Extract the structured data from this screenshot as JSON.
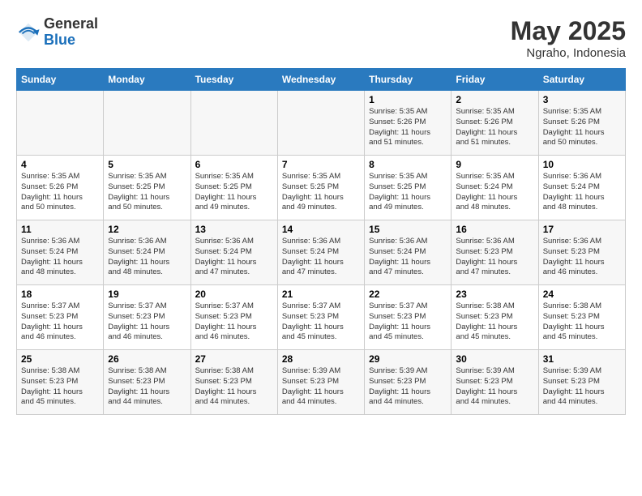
{
  "logo": {
    "general": "General",
    "blue": "Blue"
  },
  "title": "May 2025",
  "subtitle": "Ngraho, Indonesia",
  "days_of_week": [
    "Sunday",
    "Monday",
    "Tuesday",
    "Wednesday",
    "Thursday",
    "Friday",
    "Saturday"
  ],
  "weeks": [
    [
      {
        "day": "",
        "info": ""
      },
      {
        "day": "",
        "info": ""
      },
      {
        "day": "",
        "info": ""
      },
      {
        "day": "",
        "info": ""
      },
      {
        "day": "1",
        "info": "Sunrise: 5:35 AM\nSunset: 5:26 PM\nDaylight: 11 hours\nand 51 minutes."
      },
      {
        "day": "2",
        "info": "Sunrise: 5:35 AM\nSunset: 5:26 PM\nDaylight: 11 hours\nand 51 minutes."
      },
      {
        "day": "3",
        "info": "Sunrise: 5:35 AM\nSunset: 5:26 PM\nDaylight: 11 hours\nand 50 minutes."
      }
    ],
    [
      {
        "day": "4",
        "info": "Sunrise: 5:35 AM\nSunset: 5:26 PM\nDaylight: 11 hours\nand 50 minutes."
      },
      {
        "day": "5",
        "info": "Sunrise: 5:35 AM\nSunset: 5:25 PM\nDaylight: 11 hours\nand 50 minutes."
      },
      {
        "day": "6",
        "info": "Sunrise: 5:35 AM\nSunset: 5:25 PM\nDaylight: 11 hours\nand 49 minutes."
      },
      {
        "day": "7",
        "info": "Sunrise: 5:35 AM\nSunset: 5:25 PM\nDaylight: 11 hours\nand 49 minutes."
      },
      {
        "day": "8",
        "info": "Sunrise: 5:35 AM\nSunset: 5:25 PM\nDaylight: 11 hours\nand 49 minutes."
      },
      {
        "day": "9",
        "info": "Sunrise: 5:35 AM\nSunset: 5:24 PM\nDaylight: 11 hours\nand 48 minutes."
      },
      {
        "day": "10",
        "info": "Sunrise: 5:36 AM\nSunset: 5:24 PM\nDaylight: 11 hours\nand 48 minutes."
      }
    ],
    [
      {
        "day": "11",
        "info": "Sunrise: 5:36 AM\nSunset: 5:24 PM\nDaylight: 11 hours\nand 48 minutes."
      },
      {
        "day": "12",
        "info": "Sunrise: 5:36 AM\nSunset: 5:24 PM\nDaylight: 11 hours\nand 48 minutes."
      },
      {
        "day": "13",
        "info": "Sunrise: 5:36 AM\nSunset: 5:24 PM\nDaylight: 11 hours\nand 47 minutes."
      },
      {
        "day": "14",
        "info": "Sunrise: 5:36 AM\nSunset: 5:24 PM\nDaylight: 11 hours\nand 47 minutes."
      },
      {
        "day": "15",
        "info": "Sunrise: 5:36 AM\nSunset: 5:24 PM\nDaylight: 11 hours\nand 47 minutes."
      },
      {
        "day": "16",
        "info": "Sunrise: 5:36 AM\nSunset: 5:23 PM\nDaylight: 11 hours\nand 47 minutes."
      },
      {
        "day": "17",
        "info": "Sunrise: 5:36 AM\nSunset: 5:23 PM\nDaylight: 11 hours\nand 46 minutes."
      }
    ],
    [
      {
        "day": "18",
        "info": "Sunrise: 5:37 AM\nSunset: 5:23 PM\nDaylight: 11 hours\nand 46 minutes."
      },
      {
        "day": "19",
        "info": "Sunrise: 5:37 AM\nSunset: 5:23 PM\nDaylight: 11 hours\nand 46 minutes."
      },
      {
        "day": "20",
        "info": "Sunrise: 5:37 AM\nSunset: 5:23 PM\nDaylight: 11 hours\nand 46 minutes."
      },
      {
        "day": "21",
        "info": "Sunrise: 5:37 AM\nSunset: 5:23 PM\nDaylight: 11 hours\nand 45 minutes."
      },
      {
        "day": "22",
        "info": "Sunrise: 5:37 AM\nSunset: 5:23 PM\nDaylight: 11 hours\nand 45 minutes."
      },
      {
        "day": "23",
        "info": "Sunrise: 5:38 AM\nSunset: 5:23 PM\nDaylight: 11 hours\nand 45 minutes."
      },
      {
        "day": "24",
        "info": "Sunrise: 5:38 AM\nSunset: 5:23 PM\nDaylight: 11 hours\nand 45 minutes."
      }
    ],
    [
      {
        "day": "25",
        "info": "Sunrise: 5:38 AM\nSunset: 5:23 PM\nDaylight: 11 hours\nand 45 minutes."
      },
      {
        "day": "26",
        "info": "Sunrise: 5:38 AM\nSunset: 5:23 PM\nDaylight: 11 hours\nand 44 minutes."
      },
      {
        "day": "27",
        "info": "Sunrise: 5:38 AM\nSunset: 5:23 PM\nDaylight: 11 hours\nand 44 minutes."
      },
      {
        "day": "28",
        "info": "Sunrise: 5:39 AM\nSunset: 5:23 PM\nDaylight: 11 hours\nand 44 minutes."
      },
      {
        "day": "29",
        "info": "Sunrise: 5:39 AM\nSunset: 5:23 PM\nDaylight: 11 hours\nand 44 minutes."
      },
      {
        "day": "30",
        "info": "Sunrise: 5:39 AM\nSunset: 5:23 PM\nDaylight: 11 hours\nand 44 minutes."
      },
      {
        "day": "31",
        "info": "Sunrise: 5:39 AM\nSunset: 5:23 PM\nDaylight: 11 hours\nand 44 minutes."
      }
    ]
  ]
}
